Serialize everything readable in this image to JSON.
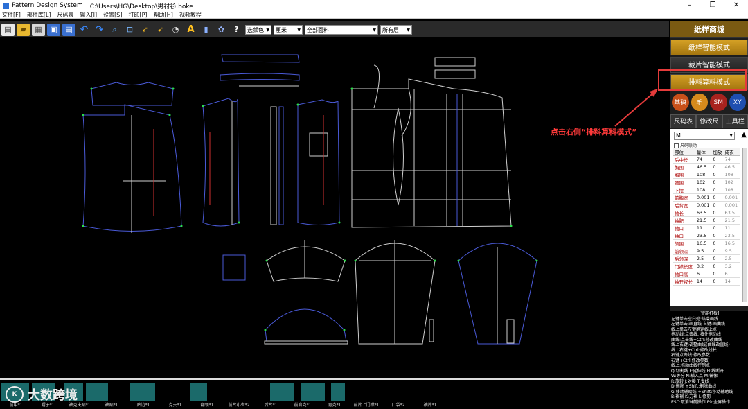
{
  "window": {
    "app_name": "Pattern Design System",
    "file_path": "C:\\Users\\HG\\Desktop\\男衬衫.boke"
  },
  "menu": [
    "文件[F]",
    "部件库[L]",
    "尺码表",
    "输入[I]",
    "设置[S]",
    "打印[P]",
    "帮助[H]",
    "视频教程"
  ],
  "toolbar": {
    "icons": [
      "new-file-icon",
      "open-folder-icon",
      "save-icon",
      "import-icon",
      "export-icon",
      "undo-icon",
      "redo-icon",
      "zoom-icon",
      "select-icon",
      "arrow-tool-icon",
      "pointer-icon",
      "dot-tool-icon",
      "text-icon",
      "grading-icon",
      "fan-icon",
      "help-icon"
    ],
    "help_glyph": "?",
    "text_glyph": "A",
    "color_select": "选颜色",
    "unit_select": "厘米",
    "fabric_select": "全部面料",
    "layer_select": "所有层"
  },
  "panel": {
    "mall": "纸样商城",
    "mode1": "纸样智能模式",
    "mode2": "裁片智能模式",
    "mode3": "排料算料模式",
    "circles": [
      {
        "label": "基码",
        "color": "#c8501a"
      },
      {
        "label": "毛",
        "color": "#d68a1c"
      },
      {
        "label": "SM",
        "color": "#a8231e"
      },
      {
        "label": "XY",
        "color": "#1f4fb0"
      }
    ],
    "tabs": [
      "尺码表",
      "修改尺寸",
      "工具栏"
    ],
    "size_select": "M",
    "checkbox_label": "尺码联动",
    "table": {
      "headers": [
        "部位",
        "量体",
        "加放",
        "成衣"
      ],
      "rows": [
        [
          "后中长",
          "74",
          "0",
          "74"
        ],
        [
          "胸围",
          "46.5",
          "0",
          "46.5"
        ],
        [
          "胸围",
          "108",
          "0",
          "108"
        ],
        [
          "腰围",
          "102",
          "0",
          "102"
        ],
        [
          "下摆",
          "108",
          "0",
          "108"
        ],
        [
          "前胸宽",
          "0.001",
          "0",
          "0.001"
        ],
        [
          "后背宽",
          "0.001",
          "0",
          "0.001"
        ],
        [
          "袖长",
          "63.5",
          "0",
          "63.5"
        ],
        [
          "袖肥",
          "21.5",
          "0",
          "21.5"
        ],
        [
          "袖口",
          "11",
          "0",
          "11"
        ],
        [
          "袖口",
          "23.5",
          "0",
          "23.5"
        ],
        [
          "领围",
          "16.5",
          "0",
          "16.5"
        ],
        [
          "前领深",
          "9.5",
          "0",
          "9.5"
        ],
        [
          "后领深",
          "2.5",
          "0",
          "2.5"
        ],
        [
          "门襟长度",
          "3.2",
          "0",
          "3.2"
        ],
        [
          "袖口高",
          "6",
          "0",
          "6"
        ],
        [
          "袖开衩长",
          "14",
          "0",
          "14"
        ]
      ]
    },
    "help": {
      "title": "[智能打板]",
      "lines": [
        "左键单击空白处:结束画线",
        "左键单击:画直线  右键:画曲线",
        "线上单击左键确定线上点",
        "拖动线:点击线, 按住拖动线",
        "曲线:点击线+Ctrl:修改曲线",
        "线上右键:调整曲线(曲线改直线)",
        "线上右键+Ctrl:修改线长",
        "右键点击线:修改参数",
        "右键+Ctrl:修改参数",
        "线上:拖动曲线控制点",
        "Q:切割线  F:延伸线  H:线断开",
        "W:等分  N:插入点  M:镜像",
        "R:旋转  J:对接  T:省线",
        "D:删除  +Shift:删除曲线",
        "G:移动辅助线  +Shift:移动辅助线",
        "B:褶裥  K:刀褶  L:修剪",
        "ESC:取消当前操作  F9:全屏操作"
      ]
    }
  },
  "tools": [
    "pencil-tool-icon",
    "ruler-tool-icon",
    "scissors-tool-icon",
    "wrench-tool-icon",
    "cut-tool-icon",
    "measure-tool-icon",
    "tape-tool-icon",
    "sew-tool-icon",
    "iron-tool-icon",
    "piece-tool-icon",
    "fold-tool-icon",
    "hammer-tool-icon"
  ],
  "tool_colors": [
    "#3a5aa0",
    "#5a8a2a",
    "#b8621a",
    "#3a6aa0",
    "#8a2a8a",
    "#b8901a",
    "#6aa02a",
    "#b8361a",
    "#3a5aa0",
    "#b8901a",
    "#b8621a",
    "#5a8a8a"
  ],
  "strip_labels": [
    "前中*1",
    "帽子*1",
    "袖克夫贴*1",
    "袖贴*1",
    "贴边*1",
    "克夫*1",
    "翻领*1",
    "前片小省*2",
    "后片*1",
    "前育克*1",
    "育克*1",
    "前片上门襟*1",
    "口袋*2",
    "袖片*1"
  ],
  "annotation": "点击右侧“排料算料模式”",
  "watermark": "大数跨境",
  "watermark_mark": "K"
}
